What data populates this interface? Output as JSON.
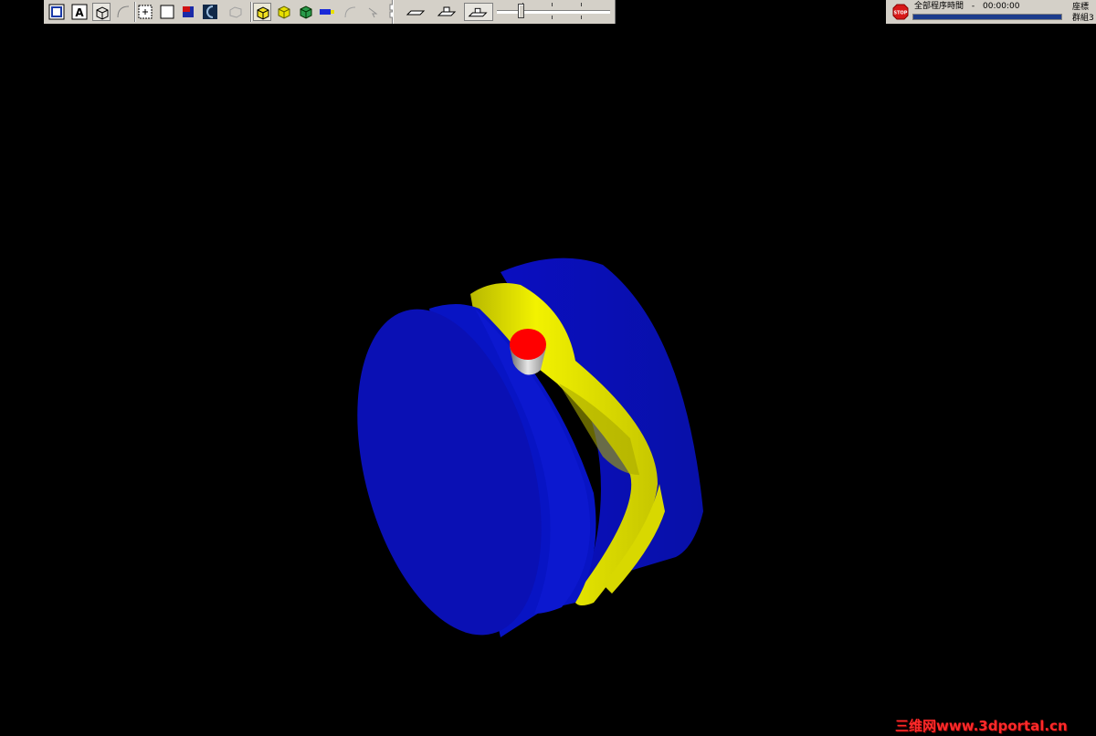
{
  "toolbar": {
    "icons": [
      "fit-view-icon",
      "text-A-icon",
      "isometric-cube-icon",
      "arc-icon",
      "point-icon",
      "rectangle-icon",
      "shaded-solid-icon",
      "half-circle-icon",
      "box-outline-icon",
      "wire-cube-icon",
      "solid-cube-icon",
      "solid-cube-green-icon",
      "tool-blue-icon",
      "arc-small-icon",
      "cursor-icon"
    ],
    "sim_buttons": [
      "tool-path-icon",
      "tool-holder-icon",
      "tool-fixture-icon"
    ]
  },
  "simulation": {
    "speed_value": 0.2,
    "progress_value": 1.0
  },
  "status": {
    "stop_label": "STOP",
    "timer_label": "全部程序時間",
    "timer_separator": "-",
    "timer_value": "00:00:00",
    "side_line1": "座標",
    "side_line2": "群組3"
  },
  "viewport": {
    "background": "#000000",
    "stock_color": "#0a10c8",
    "groove_color": "#e6e600",
    "tool_tip_color": "#ff0000",
    "tool_body_color": "#bfbfbf"
  },
  "watermark": "三维网www.3dportal.cn"
}
